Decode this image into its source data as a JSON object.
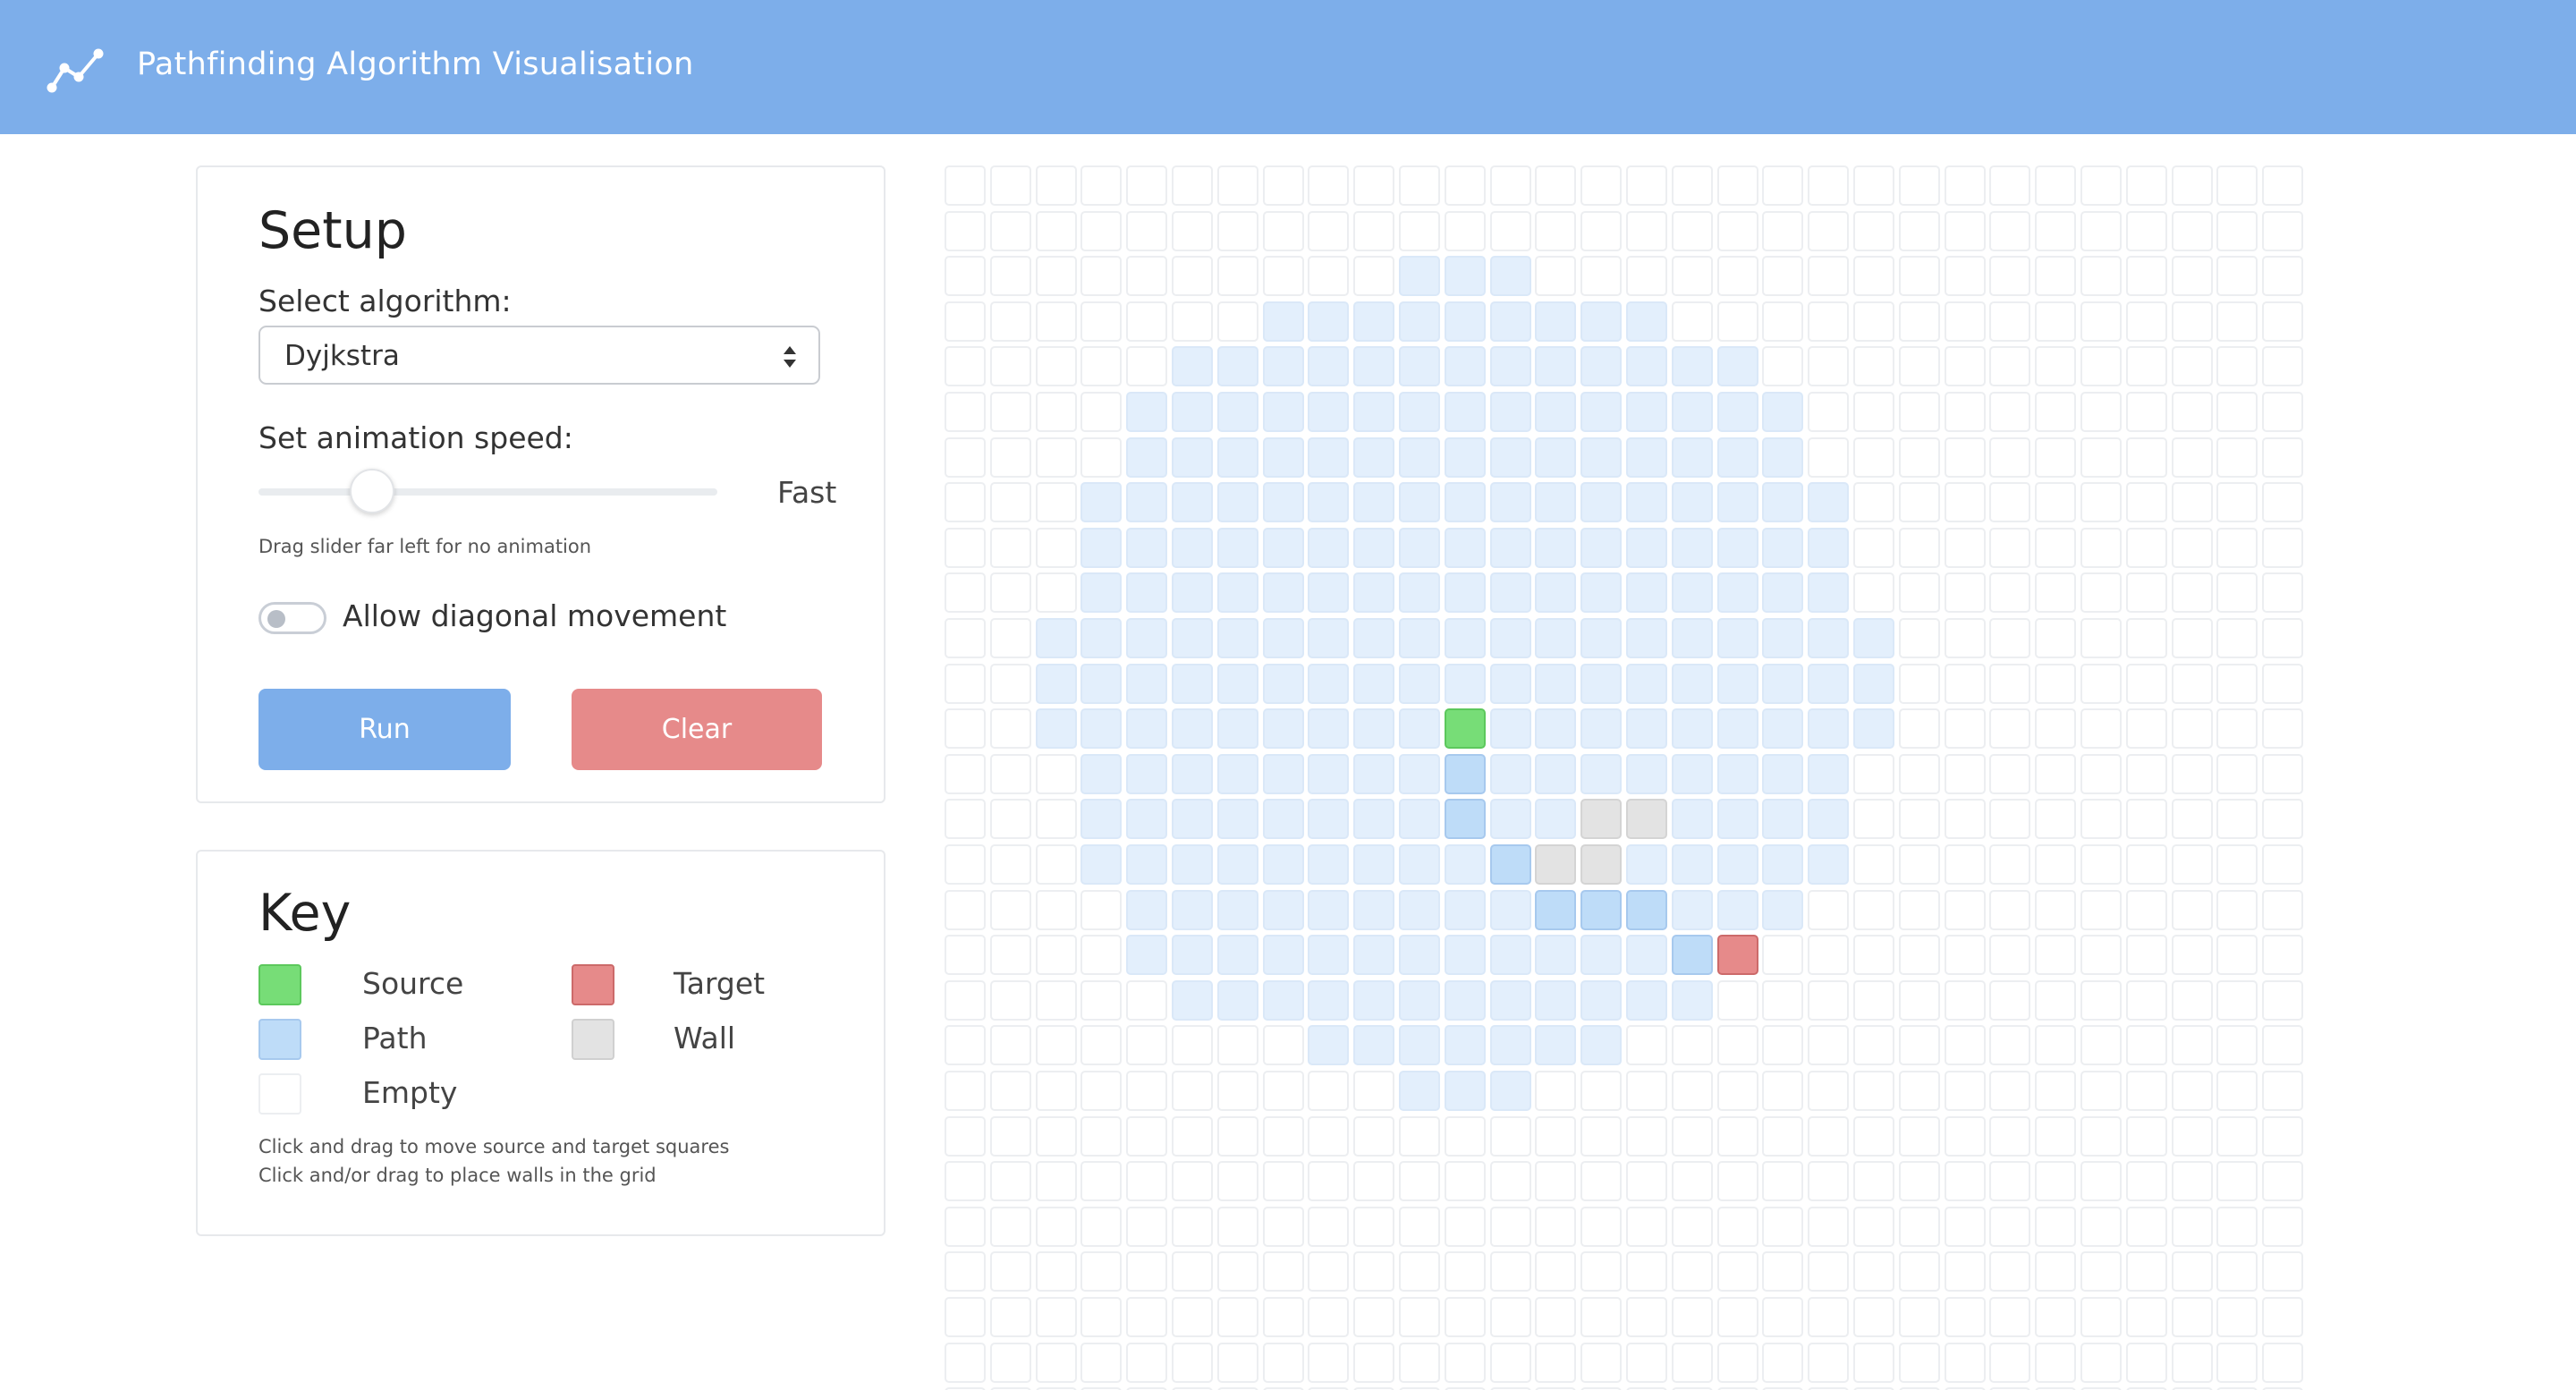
{
  "header": {
    "title": "Pathfinding Algorithm Visualisation",
    "logo_icon": "line-chart-icon"
  },
  "setup": {
    "title": "Setup",
    "algorithm_label": "Select algorithm:",
    "algorithm_value": "Dyjkstra",
    "speed_label": "Set animation speed:",
    "speed_value": "Fast",
    "speed_slider_level": 0.22,
    "speed_hint": "Drag slider far left for no animation",
    "diagonal_label": "Allow diagonal movement",
    "diagonal_enabled": false,
    "run_label": "Run",
    "clear_label": "Clear"
  },
  "key": {
    "title": "Key",
    "items": [
      {
        "label": "Source",
        "color": "#77dd77"
      },
      {
        "label": "Target",
        "color": "#e68a8a"
      },
      {
        "label": "Path",
        "color": "#bedcf8"
      },
      {
        "label": "Wall",
        "color": "#e3e3e3"
      },
      {
        "label": "Empty",
        "color": "#ffffff"
      }
    ],
    "hint_1": "Click and drag to move source and target squares",
    "hint_2": "Click and/or drag to place walls in the grid"
  },
  "colors": {
    "header": "#7daeea",
    "run_button": "#7daeea",
    "clear_button": "#e68a8a",
    "visited": "#e3effc"
  },
  "grid": {
    "columns": 30,
    "rows": 28,
    "source": [
      11,
      12
    ],
    "target": [
      17,
      17
    ],
    "visited_rows": [
      {
        "row": 2,
        "from": 10,
        "to": 12
      },
      {
        "row": 3,
        "from": 7,
        "to": 15
      },
      {
        "row": 4,
        "from": 5,
        "to": 17
      },
      {
        "row": 5,
        "from": 4,
        "to": 18
      },
      {
        "row": 6,
        "from": 4,
        "to": 18
      },
      {
        "row": 7,
        "from": 3,
        "to": 19
      },
      {
        "row": 8,
        "from": 3,
        "to": 19
      },
      {
        "row": 9,
        "from": 3,
        "to": 19
      },
      {
        "row": 10,
        "from": 2,
        "to": 20
      },
      {
        "row": 11,
        "from": 2,
        "to": 20
      },
      {
        "row": 12,
        "from": 2,
        "to": 20
      },
      {
        "row": 13,
        "from": 3,
        "to": 19
      },
      {
        "row": 14,
        "from": 3,
        "to": 19
      },
      {
        "row": 15,
        "from": 3,
        "to": 19
      },
      {
        "row": 16,
        "from": 4,
        "to": 18
      },
      {
        "row": 17,
        "from": 4,
        "to": 16
      },
      {
        "row": 18,
        "from": 5,
        "to": 16
      },
      {
        "row": 19,
        "from": 8,
        "to": 14
      },
      {
        "row": 20,
        "from": 10,
        "to": 12
      }
    ],
    "path": [
      [
        11,
        13
      ],
      [
        11,
        14
      ],
      [
        12,
        15
      ],
      [
        13,
        16
      ],
      [
        14,
        16
      ],
      [
        15,
        16
      ],
      [
        16,
        17
      ]
    ],
    "walls": [
      [
        14,
        14
      ],
      [
        15,
        14
      ],
      [
        13,
        15
      ],
      [
        14,
        15
      ]
    ]
  }
}
